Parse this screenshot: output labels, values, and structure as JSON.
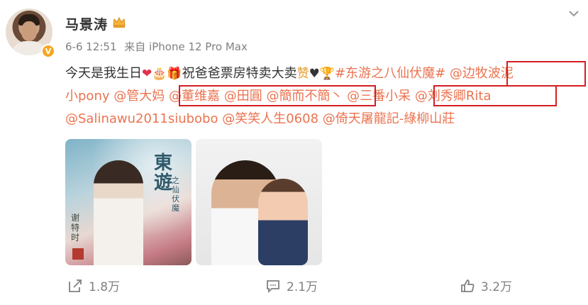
{
  "post": {
    "author": "马景涛",
    "date": "6-6 12:51",
    "source": "来自 iPhone 12 Pro Max",
    "text_1": "今天是我生日",
    "text_2": "祝爸爸票房特卖大卖",
    "hashtag": "#东游之八仙伏魔#",
    "mentions": [
      "@边牧波泥",
      "小pony",
      "@管大妈",
      "@董维嘉",
      "@田圓",
      "@簡而不簡丶",
      "@三番小呆",
      "@刘秀卿Rita",
      "@Salinawu2011siubobo",
      "@笑笑人生0608",
      "@倚天屠龍記-綠柳山莊"
    ]
  },
  "photo1": {
    "title": "東遊",
    "subtitle": "之仙伏魔",
    "side": "谢特时"
  },
  "actions": {
    "repost": "1.8万",
    "comment": "2.1万",
    "like": "3.2万"
  },
  "colors": {
    "link": "#eb7350",
    "highlight_box": "#d21e22",
    "badge": "#f5a623"
  }
}
